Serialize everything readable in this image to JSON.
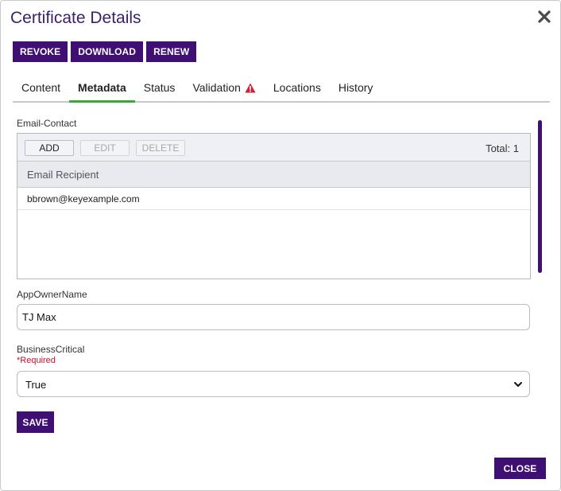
{
  "dialog": {
    "title": "Certificate Details"
  },
  "actions": {
    "revoke_label": "REVOKE",
    "download_label": "DOWNLOAD",
    "renew_label": "RENEW"
  },
  "tabs": [
    {
      "label": "Content",
      "active": false
    },
    {
      "label": "Metadata",
      "active": true
    },
    {
      "label": "Status",
      "active": false
    },
    {
      "label": "Validation",
      "active": false,
      "icon": "warning-icon"
    },
    {
      "label": "Locations",
      "active": false
    },
    {
      "label": "History",
      "active": false
    }
  ],
  "email_contact": {
    "label": "Email-Contact",
    "toolbar": {
      "add_label": "ADD",
      "edit_label": "EDIT",
      "delete_label": "DELETE",
      "total_text": "Total: 1"
    },
    "columns": [
      "Email Recipient"
    ],
    "rows": [
      {
        "email": "bbrown@keyexample.com"
      }
    ]
  },
  "app_owner": {
    "label": "AppOwnerName",
    "value": "TJ Max"
  },
  "business_critical": {
    "label": "BusinessCritical",
    "required_text": "*Required",
    "selected": "True"
  },
  "footer": {
    "save_label": "SAVE",
    "close_label": "CLOSE"
  },
  "colors": {
    "brand_purple": "#3f0f73",
    "title_purple": "#3b1f6b",
    "active_tab_underline": "#3aa83a",
    "warning_red": "#d21f3c",
    "required_red": "#c8102e"
  }
}
